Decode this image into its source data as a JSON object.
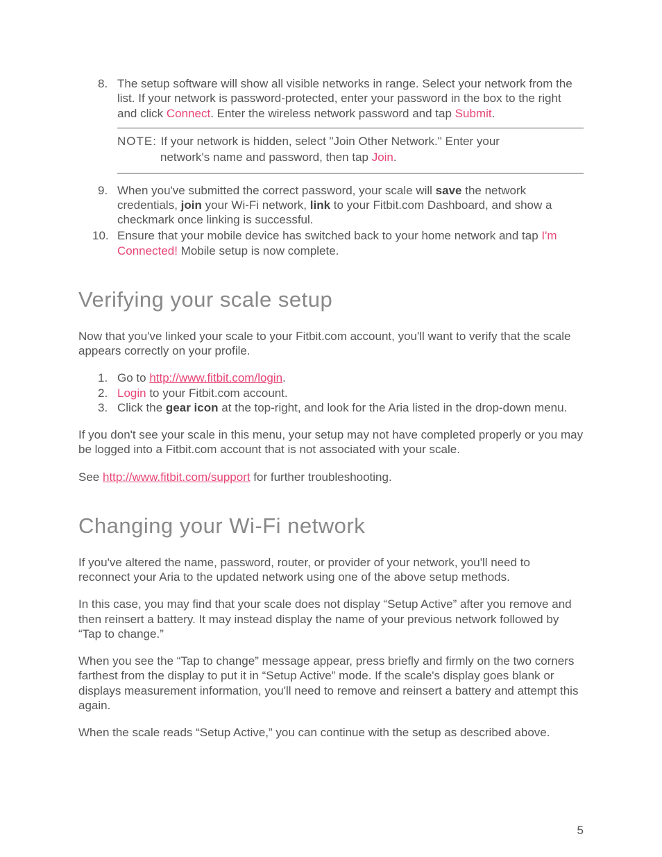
{
  "list1": {
    "item8": {
      "num": "8.",
      "pre": "The setup software will show all visible networks in range. Select your network from the list. If your network is password-protected, enter your password in the box to the right and click ",
      "connect": "Connect",
      "mid": ". Enter the wireless network password and tap ",
      "submit": "Submit",
      "post": "."
    },
    "note": {
      "label": "NOTE: ",
      "line1": "If your network is hidden, select \"Join Other Network.\" Enter your",
      "line2pre": "network's name and password, then tap ",
      "join": "Join",
      "line2post": "."
    },
    "item9": {
      "num": "9.",
      "pre": "When you've submitted the correct password, your scale will ",
      "save": "save",
      "mid1": " the network credentials, ",
      "joinb": "join",
      "mid2": " your Wi-Fi network, ",
      "linkb": "link",
      "post": " to your Fitbit.com Dashboard, and show a checkmark once linking is successful."
    },
    "item10": {
      "num": "10.",
      "pre": "Ensure that your mobile device has switched back to your home network and tap ",
      "connected": "I'm Connected!",
      "post": " Mobile setup is now complete."
    }
  },
  "verify": {
    "heading": "Verifying your scale setup",
    "intro": "Now that you've linked your scale to your Fitbit.com account, you'll want to verify that the scale appears correctly on your profile.",
    "step1": {
      "num": "1.",
      "pre": "Go to ",
      "url": "http://www.fitbit.com/login",
      "post": "."
    },
    "step2": {
      "num": "2.",
      "login": "Login",
      "post": " to your Fitbit.com account."
    },
    "step3": {
      "num": "3.",
      "pre": "Click the ",
      "gear": "gear icon",
      "post": " at the top-right, and look for the Aria listed in the drop-down menu."
    },
    "para2": "If you don't see your scale in this menu, your setup may not have completed properly or you may be logged into a Fitbit.com account that is not associated with your scale.",
    "para3pre": "See ",
    "para3url": "http://www.fitbit.com/support",
    "para3post": " for further troubleshooting."
  },
  "wifi": {
    "heading": "Changing your Wi-Fi network",
    "p1": "If you've altered the name, password, router, or provider of your network, you'll need to reconnect your Aria to the updated network using one of the above setup methods.",
    "p2": "In this case, you may find that your scale does not display “Setup Active” after you remove and then reinsert a battery. It may instead display the name of your previous network followed by “Tap to change.”",
    "p3": "When you see the “Tap to change” message appear, press briefly and firmly on the two corners farthest from the display to put it in “Setup Active” mode. If the scale's display goes blank or displays measurement information, you'll need to remove and reinsert a battery and attempt this again.",
    "p4": "When the scale reads “Setup Active,” you can continue with the setup as described above."
  },
  "pageNumber": "5"
}
